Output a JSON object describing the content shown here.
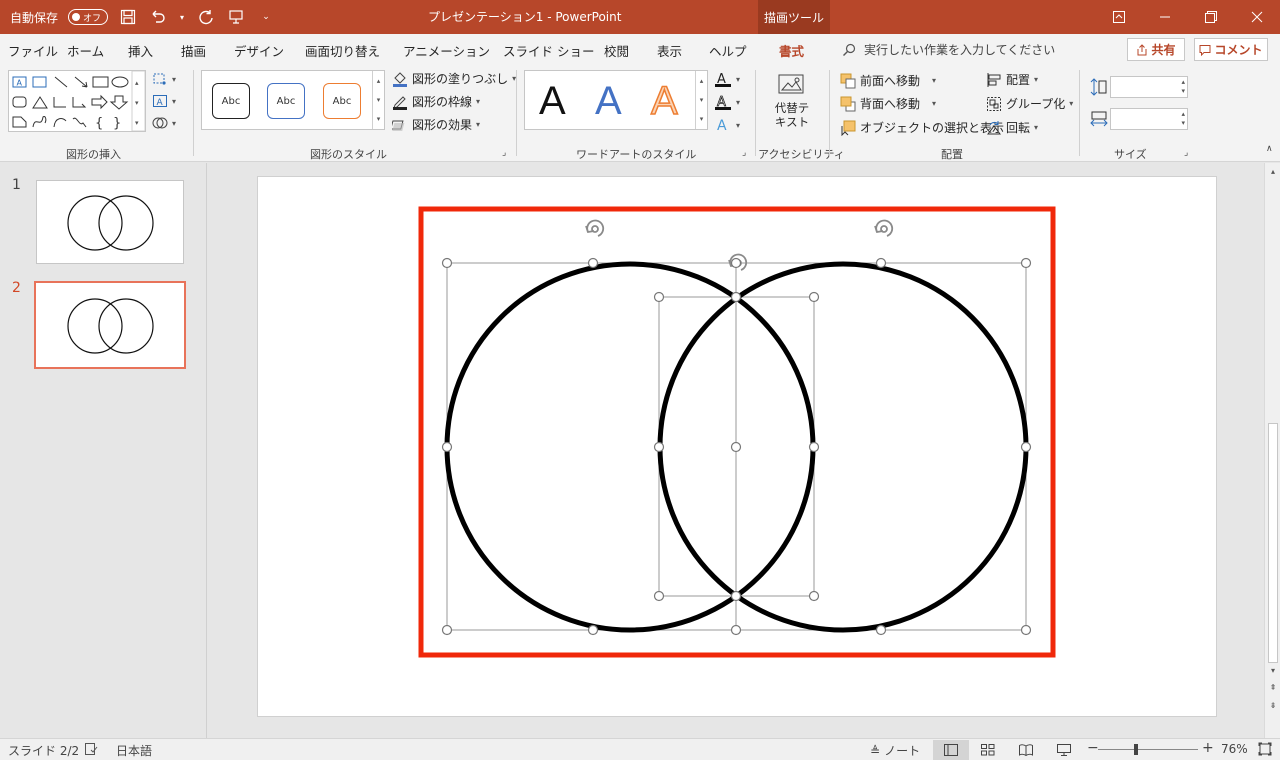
{
  "titlebar": {
    "autosave_label": "自動保存",
    "autosave_state": "オフ",
    "document_title": "プレゼンテーション1  -  PowerPoint",
    "context_tab": "描画ツール"
  },
  "tabs": [
    {
      "label": "ファイル"
    },
    {
      "label": "ホーム"
    },
    {
      "label": "挿入"
    },
    {
      "label": "描画"
    },
    {
      "label": "デザイン"
    },
    {
      "label": "画面切り替え"
    },
    {
      "label": "アニメーション"
    },
    {
      "label": "スライド ショー"
    },
    {
      "label": "校閲"
    },
    {
      "label": "表示"
    },
    {
      "label": "ヘルプ"
    },
    {
      "label": "書式"
    }
  ],
  "tell_me": "実行したい作業を入力してください",
  "share_label": "共有",
  "comment_label": "コメント",
  "ribbon": {
    "insert_shapes_label": "図形の挿入",
    "shape_styles_label": "図形のスタイル",
    "abc_samples": [
      "Abc",
      "Abc",
      "Abc"
    ],
    "shape_fill": "図形の塗りつぶし",
    "shape_outline": "図形の枠線",
    "shape_effects": "図形の効果",
    "wordart_label": "ワードアートのスタイル",
    "wordart_letters": [
      "A",
      "A",
      "A"
    ],
    "alt_text": [
      "代替テ",
      "キスト"
    ],
    "accessibility_label": "アクセシビリティ",
    "bring_forward": "前面へ移動",
    "send_backward": "背面へ移動",
    "selection_pane": "オブジェクトの選択と表示",
    "align": "配置",
    "group": "グループ化",
    "rotate": "回転",
    "arrange_label": "配置",
    "size_label": "サイズ"
  },
  "slides": [
    {
      "number": "1"
    },
    {
      "number": "2"
    }
  ],
  "status": {
    "slide_indicator": "スライド 2/2",
    "language": "日本語",
    "notes": "ノート",
    "zoom_minus": "−",
    "zoom_plus": "+",
    "zoom": "76%"
  },
  "colors": {
    "accent": "#b7472a",
    "highlight_frame": "#f0280a"
  }
}
